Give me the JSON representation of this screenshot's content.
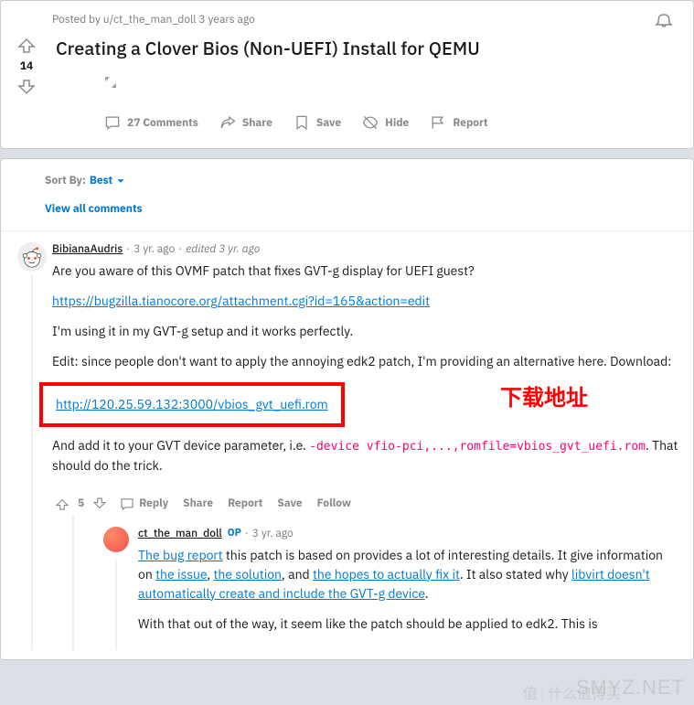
{
  "post": {
    "posted_prefix": "Posted by ",
    "author": "u/ct_the_man_doll",
    "age": "3 years ago",
    "score": "14",
    "title": "Creating a Clover Bios (Non-UEFI) Install for QEMU",
    "actions": {
      "comments": "27 Comments",
      "share": "Share",
      "save": "Save",
      "hide": "Hide",
      "report": "Report"
    }
  },
  "sort": {
    "label": "Sort By:",
    "value": "Best",
    "view_all": "View all comments"
  },
  "comment1": {
    "author": "BibianaAudris",
    "age": "3 yr. ago",
    "edited": "edited 3 yr. ago",
    "p1": "Are you aware of this OVMF patch that fixes GVT-g display for UEFI guest?",
    "link1": "https://bugzilla.tianocore.org/attachment.cgi?id=165&action=edit",
    "p2": "I'm using it in my GVT-g setup and it works perfectly.",
    "p3": "Edit: since people don't want to apply the annoying edk2 patch, I'm providing an alternative here. Download:",
    "link2": "http://120.25.59.132:3000/vbios_gvt_uefi.rom",
    "annotation": "下载地址",
    "p4a": "And add it to your GVT device parameter, i.e. ",
    "code1": "-device vfio-pci,...,romfile=vbios_gvt_uefi.rom",
    "p4b": ". That should do the trick.",
    "score": "5",
    "actions": {
      "reply": "Reply",
      "share": "Share",
      "report": "Report",
      "save": "Save",
      "follow": "Follow"
    }
  },
  "comment2": {
    "author": "ct_the_man_doll",
    "op": "OP",
    "age": "3 yr. ago",
    "link_bug": "The bug report",
    "t1": " this patch is based on provides a lot of interesting details. It give information on ",
    "link_issue": "the issue",
    "sep1": ", ",
    "link_solution": "the solution",
    "sep2": ", and ",
    "link_hopes": "the hopes to actually fix it",
    "t2": ". It also stated why ",
    "link_libvirt": "libvirt doesn't automatically create and include the GVT-g device",
    "t3": ".",
    "p2": "With that out of the way, it seem like the patch should be applied to edk2. This is"
  },
  "watermark1": "SMYZ.NET",
  "watermark2": "值 | 什么值得买"
}
